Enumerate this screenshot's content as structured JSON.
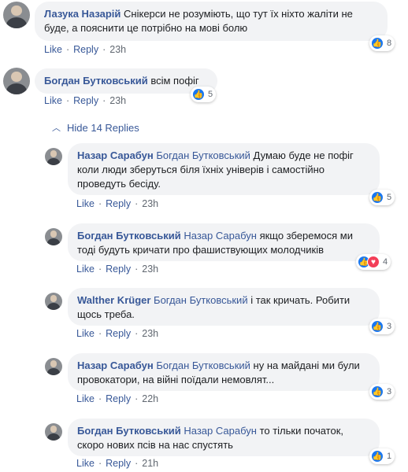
{
  "comments": [
    {
      "name": "Лазука Назарій",
      "mention": "",
      "lines": [
        "Снікерси не розуміють, що тут їх ніхто жаліти не",
        "буде, а пояснити це потрібно на мові болю"
      ],
      "like": "Like",
      "reply": "Reply",
      "time": "23h",
      "reactions": {
        "like": true,
        "love": false,
        "count": "8"
      }
    },
    {
      "name": "Богдан Бутковський",
      "mention": "",
      "lines": [
        "всім пофіг"
      ],
      "like": "Like",
      "reply": "Reply",
      "time": "23h",
      "reactions": {
        "like": true,
        "love": false,
        "count": "5"
      }
    }
  ],
  "hide_replies": "Hide 14 Replies",
  "replies": [
    {
      "name": "Назар Сарабун",
      "mention": "Богдан Бутковський",
      "lines": [
        "Думаю буде не пофіг",
        "коли люди зберуться біля їхніх універів і самостійно",
        "проведуть бесіду."
      ],
      "like": "Like",
      "reply": "Reply",
      "time": "23h",
      "reactions": {
        "like": true,
        "love": false,
        "count": "5"
      }
    },
    {
      "name": "Богдан Бутковський",
      "mention": "Назар Сарабун",
      "lines": [
        "якщо зберемося ми",
        "тоді будуть кричати про фашиствующих молодчиків"
      ],
      "like": "Like",
      "reply": "Reply",
      "time": "23h",
      "reactions": {
        "like": true,
        "love": true,
        "count": "4"
      }
    },
    {
      "name": "Walther Krüger",
      "mention": "Богдан Бутковський",
      "lines": [
        "і так кричать. Робити",
        "щось треба."
      ],
      "like": "Like",
      "reply": "Reply",
      "time": "23h",
      "reactions": {
        "like": true,
        "love": false,
        "count": "3"
      }
    },
    {
      "name": "Назар Сарабун",
      "mention": "Богдан Бутковський",
      "lines": [
        "ну на майдані ми були",
        "провокатори, на війні поїдали немовлят..."
      ],
      "like": "Like",
      "reply": "Reply",
      "time": "22h",
      "reactions": {
        "like": true,
        "love": false,
        "count": "3"
      }
    },
    {
      "name": "Богдан Бутковський",
      "mention": "Назар Сарабун",
      "lines": [
        "то тільки початок,",
        "скоро нових псів на нас спустять"
      ],
      "like": "Like",
      "reply": "Reply",
      "time": "21h",
      "reactions": {
        "like": true,
        "love": false,
        "count": "1"
      }
    }
  ],
  "colors": {
    "link": "#385898",
    "bubble": "#f2f3f5",
    "like": "#1877f2",
    "love": "#f33e58",
    "meta": "#606770"
  },
  "icons": {
    "like": "thumbs-up-icon",
    "love": "heart-icon",
    "chevron": "chevron-up-icon"
  }
}
